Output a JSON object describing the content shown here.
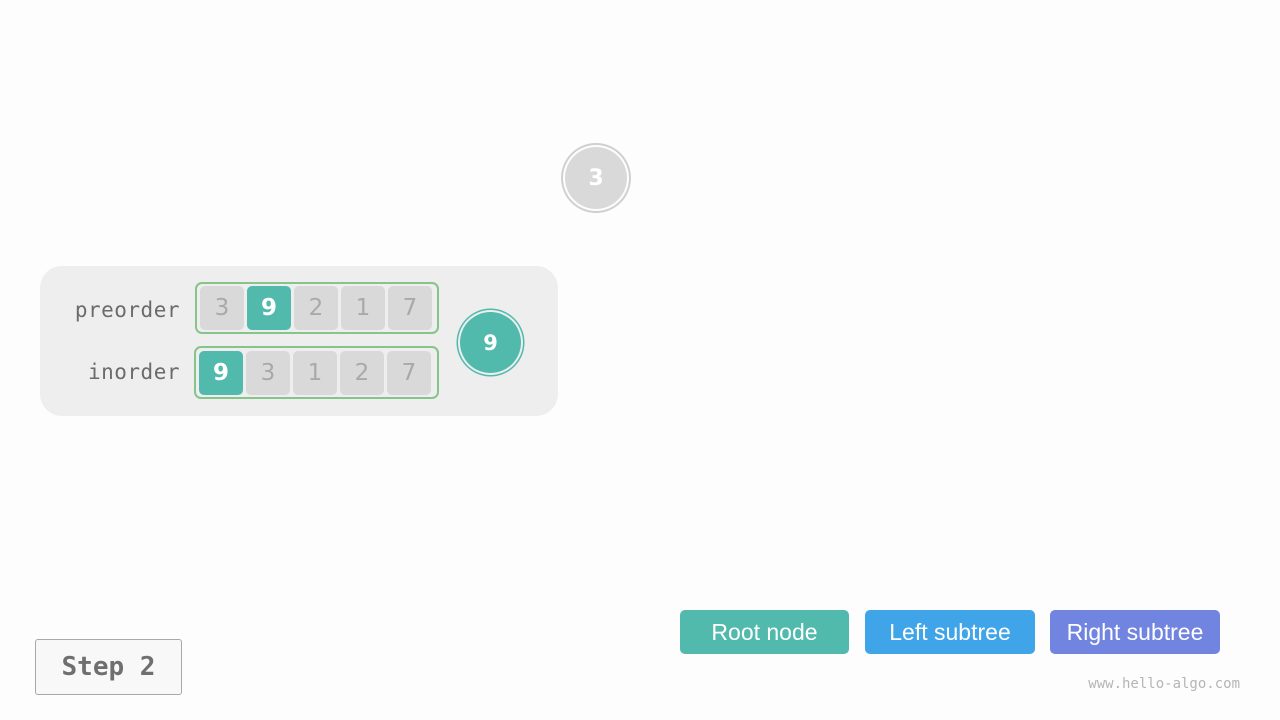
{
  "tree": {
    "root_node": {
      "value": "3",
      "color": "#d9d9d9"
    }
  },
  "panel": {
    "preorder": {
      "label": "preorder",
      "values": [
        "3",
        "9",
        "2",
        "1",
        "7"
      ],
      "active_index": 1
    },
    "inorder": {
      "label": "inorder",
      "values": [
        "9",
        "3",
        "1",
        "2",
        "7"
      ],
      "active_index": 0
    },
    "current_node": {
      "value": "9",
      "color": "#52b9ad"
    }
  },
  "step": {
    "label": "Step 2"
  },
  "legend": {
    "root": {
      "label": "Root node",
      "color": "#52b9ad"
    },
    "left": {
      "label": "Left subtree",
      "color": "#3fa4e8"
    },
    "right": {
      "label": "Right subtree",
      "color": "#7184df"
    }
  },
  "watermark": "www.hello-algo.com",
  "colors": {
    "highlight": "#52b9ad",
    "inactive_cell": "#d9d9d9",
    "array_border": "#86c48a",
    "panel_background": "#eeeeee"
  }
}
